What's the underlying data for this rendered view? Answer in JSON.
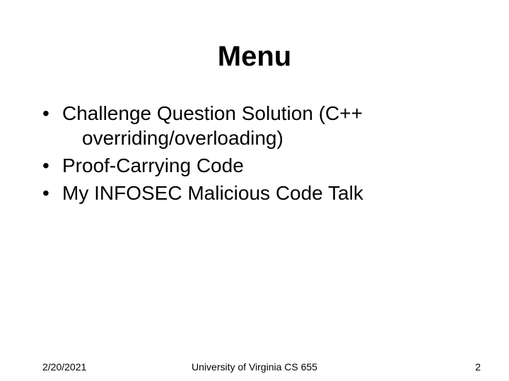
{
  "title": "Menu",
  "bullets": [
    {
      "line1": "Challenge Question Solution (C++",
      "line2": "overriding/overloading)"
    },
    {
      "line1": "Proof-Carrying Code"
    },
    {
      "line1": "My INFOSEC Malicious Code Talk"
    }
  ],
  "footer": {
    "date": "2/20/2021",
    "center": "University of Virginia CS 655",
    "page": "2"
  }
}
